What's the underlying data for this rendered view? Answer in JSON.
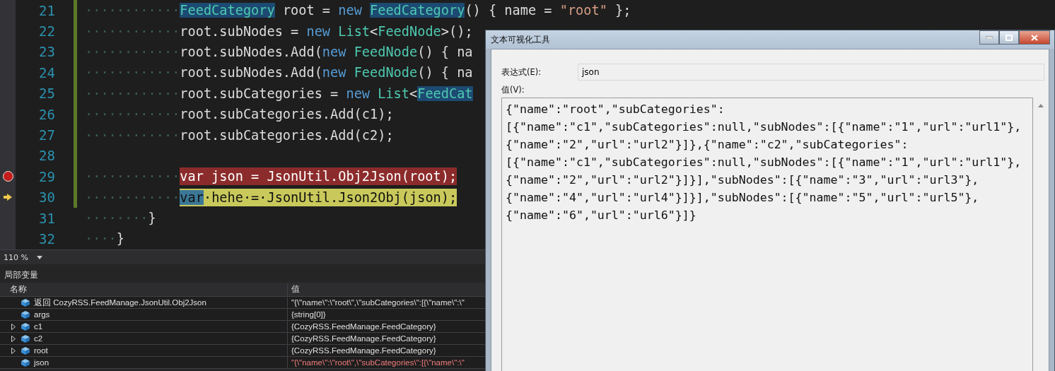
{
  "editor": {
    "lines": [
      {
        "number": "21",
        "changed": true,
        "breakpoint": false,
        "current": false,
        "indent": "············",
        "tokens": [
          {
            "kind": "highlighted",
            "text": "FeedCategory"
          },
          {
            "kind": "plain",
            "text": " root = "
          },
          {
            "kind": "keyword",
            "text": "new "
          },
          {
            "kind": "highlighted",
            "text": "FeedCategory"
          },
          {
            "kind": "plain",
            "text": "() { name = "
          },
          {
            "kind": "string",
            "text": "\"root\""
          },
          {
            "kind": "plain",
            "text": " };"
          }
        ]
      },
      {
        "number": "22",
        "changed": true,
        "breakpoint": false,
        "current": false,
        "indent": "············",
        "tokens": [
          {
            "kind": "plain",
            "text": "root.subNodes = "
          },
          {
            "kind": "keyword",
            "text": "new "
          },
          {
            "kind": "type",
            "text": "List"
          },
          {
            "kind": "plain",
            "text": "<"
          },
          {
            "kind": "type",
            "text": "FeedNode"
          },
          {
            "kind": "plain",
            "text": ">();"
          }
        ]
      },
      {
        "number": "23",
        "changed": true,
        "breakpoint": false,
        "current": false,
        "indent": "············",
        "tokens": [
          {
            "kind": "plain",
            "text": "root.subNodes.Add("
          },
          {
            "kind": "keyword",
            "text": "new "
          },
          {
            "kind": "type",
            "text": "FeedNode"
          },
          {
            "kind": "plain",
            "text": "() { na"
          }
        ]
      },
      {
        "number": "24",
        "changed": true,
        "breakpoint": false,
        "current": false,
        "indent": "············",
        "tokens": [
          {
            "kind": "plain",
            "text": "root.subNodes.Add("
          },
          {
            "kind": "keyword",
            "text": "new "
          },
          {
            "kind": "type",
            "text": "FeedNode"
          },
          {
            "kind": "plain",
            "text": "() { na"
          }
        ]
      },
      {
        "number": "25",
        "changed": true,
        "breakpoint": false,
        "current": false,
        "indent": "············",
        "tokens": [
          {
            "kind": "plain",
            "text": "root.subCategories = "
          },
          {
            "kind": "keyword",
            "text": "new "
          },
          {
            "kind": "type",
            "text": "List"
          },
          {
            "kind": "plain",
            "text": "<"
          },
          {
            "kind": "highlighted",
            "text": "FeedCat"
          }
        ]
      },
      {
        "number": "26",
        "changed": true,
        "breakpoint": false,
        "current": false,
        "indent": "············",
        "tokens": [
          {
            "kind": "plain",
            "text": "root.subCategories.Add(c1);"
          }
        ]
      },
      {
        "number": "27",
        "changed": true,
        "breakpoint": false,
        "current": false,
        "indent": "············",
        "tokens": [
          {
            "kind": "plain",
            "text": "root.subCategories.Add(c2);"
          }
        ]
      },
      {
        "number": "28",
        "changed": true,
        "breakpoint": false,
        "current": false
      },
      {
        "number": "29",
        "changed": true,
        "breakpoint": true,
        "current": false,
        "indent": "············",
        "tokens": [
          {
            "kind": "plain",
            "text": "var json = JsonUtil.Obj2Json(root);"
          }
        ]
      },
      {
        "number": "30",
        "changed": true,
        "breakpoint": false,
        "current": true,
        "indent": "············",
        "tokens": [
          {
            "kind": "highlighted",
            "text": "var"
          },
          {
            "kind": "plain",
            "text": "·hehe·=·JsonUtil.Json2Obj(json);"
          }
        ]
      },
      {
        "number": "31",
        "changed": false,
        "breakpoint": false,
        "current": false,
        "indent": "········",
        "tokens": [
          {
            "kind": "plain",
            "text": "}"
          }
        ]
      },
      {
        "number": "32",
        "changed": false,
        "breakpoint": false,
        "current": false,
        "indent": "····",
        "tokens": [
          {
            "kind": "plain",
            "text": "}"
          }
        ]
      }
    ],
    "zoom": "110 %"
  },
  "locals": {
    "title": "局部变量",
    "columns": [
      "名称",
      "值"
    ],
    "rows": [
      {
        "expandable": false,
        "changed": false,
        "name": "返回 CozyRSS.FeedManage.JsonUtil.Obj2Json",
        "value": "\"{\\\"name\\\":\\\"root\\\",\\\"subCategories\\\":[{\\\"name\\\":\\\""
      },
      {
        "expandable": false,
        "changed": false,
        "name": "args",
        "value": "{string[0]}"
      },
      {
        "expandable": true,
        "changed": false,
        "name": "c1",
        "value": "{CozyRSS.FeedManage.FeedCategory}"
      },
      {
        "expandable": true,
        "changed": false,
        "name": "c2",
        "value": "{CozyRSS.FeedManage.FeedCategory}"
      },
      {
        "expandable": true,
        "changed": false,
        "name": "root",
        "value": "{CozyRSS.FeedManage.FeedCategory}"
      },
      {
        "expandable": false,
        "changed": true,
        "name": "json",
        "value": "\"{\\\"name\\\":\\\"root\\\",\\\"subCategories\\\":[{\\\"name\\\":\\\""
      }
    ]
  },
  "dialog": {
    "title": "文本可视化工具",
    "expression_label": "表达式(E):",
    "expression": "json",
    "value_label": "值(V):",
    "value_lines": [
      "{\"name\":\"root\",\"subCategories\":",
      "[{\"name\":\"c1\",\"subCategories\":null,\"subNodes\":[{\"name\":\"1\",\"url\":\"url1\"},",
      "{\"name\":\"2\",\"url\":\"url2\"}]},{\"name\":\"c2\",\"subCategories\":",
      "[{\"name\":\"c1\",\"subCategories\":null,\"subNodes\":[{\"name\":\"1\",\"url\":\"url1\"},",
      "{\"name\":\"2\",\"url\":\"url2\"}]}],\"subNodes\":[{\"name\":\"3\",\"url\":\"url3\"},",
      "{\"name\":\"4\",\"url\":\"url4\"}]}],\"subNodes\":[{\"name\":\"5\",\"url\":\"url5\"},",
      "{\"name\":\"6\",\"url\":\"url6\"}]}"
    ]
  }
}
